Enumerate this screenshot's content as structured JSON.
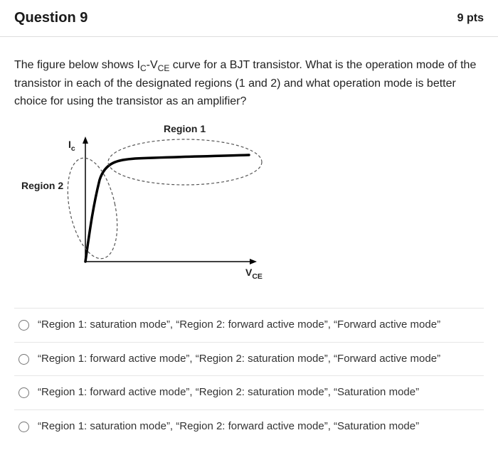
{
  "header": {
    "title": "Question 9",
    "points": "9 pts"
  },
  "prompt": {
    "pre": "The figure below shows I",
    "sub1": "C",
    "mid1": "-V",
    "sub2": "CE",
    "post": " curve for a BJT transistor. What is the operation mode of the transistor in each of the designated regions (1 and 2) and what operation mode is better choice for using the transistor as an amplifier?"
  },
  "figure": {
    "region1": "Region 1",
    "region2": "Region 2",
    "ylabel_main": "I",
    "ylabel_sub": "c",
    "xlabel_main": "V",
    "xlabel_sub": "CE"
  },
  "options": [
    "“Region 1: saturation mode”, “Region 2: forward active mode”, “Forward active mode”",
    "“Region 1: forward active mode”, “Region 2: saturation mode”, “Forward active mode”",
    "“Region 1: forward active mode”, “Region 2: saturation mode”, “Saturation mode”",
    "“Region 1: saturation mode”, “Region 2: forward active mode”, “Saturation mode”"
  ],
  "chart_data": {
    "type": "line",
    "title": "Ic-Vce curve for a BJT transistor",
    "xlabel": "V_CE",
    "ylabel": "I_c",
    "series": [
      {
        "name": "Ic",
        "x": [
          0,
          0.1,
          0.2,
          0.3,
          0.5,
          1.0,
          2.0,
          3.0
        ],
        "y": [
          0,
          3.0,
          5.5,
          7.0,
          8.0,
          8.4,
          8.7,
          8.9
        ]
      }
    ],
    "annotations": [
      {
        "region": 1,
        "label": "Region 1",
        "shape": "ellipse",
        "covers": "flat upper portion (forward active region)"
      },
      {
        "region": 2,
        "label": "Region 2",
        "shape": "ellipse",
        "covers": "steep rising portion near origin (saturation region)"
      }
    ],
    "xlim": [
      0,
      3.2
    ],
    "ylim": [
      0,
      10
    ]
  }
}
